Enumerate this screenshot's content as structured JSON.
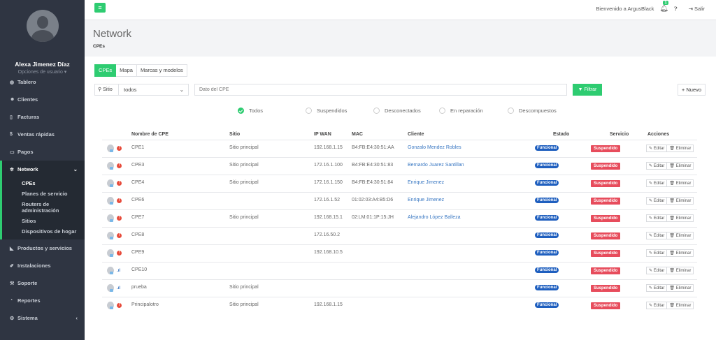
{
  "sidebar": {
    "user_name": "Alexa Jimenez Díaz",
    "user_options": "Opciones de usuario ▾",
    "menu": [
      {
        "label": "Tablero",
        "icon": "dashboard-icon"
      },
      {
        "label": "Clientes",
        "icon": "users-icon"
      },
      {
        "label": "Facturas",
        "icon": "invoice-icon"
      },
      {
        "label": "Ventas rápidas",
        "icon": "dollar-icon"
      },
      {
        "label": "Pagos",
        "icon": "money-icon"
      }
    ],
    "network": {
      "label": "Network",
      "icon": "network-icon"
    },
    "submenu": [
      "CPEs",
      "Planes de servicio",
      "Routers de administración",
      "Sitios",
      "Dispositivos de hogar"
    ],
    "menu2": [
      {
        "label": "Productos y servicios",
        "icon": "tag-icon"
      },
      {
        "label": "Instalaciones",
        "icon": "install-icon"
      },
      {
        "label": "Soporte",
        "icon": "wrench-icon"
      },
      {
        "label": "Reportes",
        "icon": "chart-icon"
      },
      {
        "label": "Sistema",
        "icon": "cogs-icon"
      }
    ]
  },
  "topbar": {
    "welcome": "Bienvenido a ArgusBlack",
    "notifications": "1",
    "logout": "Salir"
  },
  "header": {
    "title": "Network",
    "breadcrumb": "CPEs"
  },
  "tabs": [
    "CPEs",
    "Mapa",
    "Marcas y modelos"
  ],
  "filter": {
    "site_label": "Sitio",
    "site_value": "todos",
    "cpe_placeholder": "Dato del CPE",
    "filter_button": "Filtrar",
    "new_button": "+ Nuevo"
  },
  "status_filters": [
    "Todos",
    "Suspendidos",
    "Desconectados",
    "En reparación",
    "Descompuestos"
  ],
  "table": {
    "headers": [
      "Nombre de CPE",
      "Sitio",
      "IP WAN",
      "MAC",
      "Cliente",
      "Estado",
      "Servicio",
      "Acciones"
    ],
    "status_label": "Funcional",
    "service_label": "Suspendido",
    "edit_label": "Editar",
    "delete_label": "Eliminar",
    "rows": [
      {
        "name": "CPE1",
        "site": "Sitio principal",
        "ip": "192.168.1.15",
        "mac": "B4:FB:E4:30:51:AA",
        "client": "Gonzalo Mendez Robles",
        "signal": "error"
      },
      {
        "name": "CPE3",
        "site": "Sitio principal",
        "ip": "172.16.1.100",
        "mac": "B4:FB:E4:30:51:83",
        "client": "Bernardo Juarez Santillan",
        "signal": "error"
      },
      {
        "name": "CPE4",
        "site": "Sitio principal",
        "ip": "172.16.1.150",
        "mac": "B4:FB:E4:30:51:84",
        "client": "Enrique Jimenez",
        "signal": "error"
      },
      {
        "name": "CPE6",
        "site": "",
        "ip": "172.16.1.52",
        "mac": "01:02:03:A4:B5:D6",
        "client": "Enrique Jimenez",
        "signal": "error"
      },
      {
        "name": "CPE7",
        "site": "Sitio principal",
        "ip": "192.168.15.1",
        "mac": "02:LM:01:1P:15:JH",
        "client": "Alejandro López Balleza",
        "signal": "error"
      },
      {
        "name": "CPE8",
        "site": "",
        "ip": "172.16.50.2",
        "mac": "",
        "client": "",
        "signal": "error"
      },
      {
        "name": "CPE9",
        "site": "",
        "ip": "192.168.10.5",
        "mac": "",
        "client": "",
        "signal": "error"
      },
      {
        "name": "CPE10",
        "site": "",
        "ip": "",
        "mac": "",
        "client": "",
        "signal": "ok"
      },
      {
        "name": "prueba",
        "site": "Sitio principal",
        "ip": "",
        "mac": "",
        "client": "",
        "signal": "ok"
      },
      {
        "name": "Principalotro",
        "site": "Sitio principal",
        "ip": "192.168.1.15",
        "mac": "",
        "client": "",
        "signal": "error"
      }
    ]
  },
  "colors": {
    "accent": "#2ecc71",
    "sidebar": "#2f3542",
    "funcional": "#1f5fbf",
    "suspendido": "#e74c5c",
    "link": "#3a78c3"
  }
}
